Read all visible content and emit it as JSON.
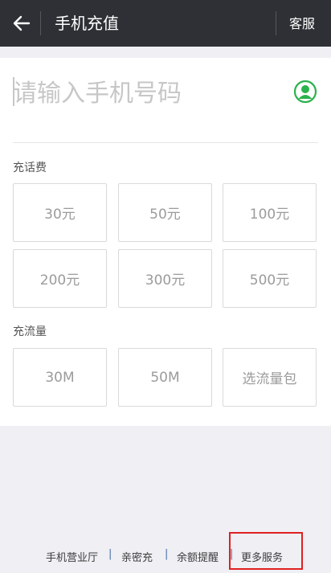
{
  "header": {
    "title": "手机充值",
    "service_label": "客服"
  },
  "phone": {
    "placeholder": "请输入手机号码"
  },
  "recharge_fee": {
    "label": "充话费",
    "options": [
      "30元",
      "50元",
      "100元",
      "200元",
      "300元",
      "500元"
    ]
  },
  "recharge_data": {
    "label": "充流量",
    "options": [
      "30M",
      "50M",
      "选流量包"
    ]
  },
  "footer": {
    "links": [
      "手机营业厅",
      "亲密充",
      "余额提醒",
      "更多服务"
    ],
    "separator": "|"
  },
  "colors": {
    "header_bg": "#2e3035",
    "contact_icon": "#2bb24c",
    "highlight_border": "#e02020"
  }
}
